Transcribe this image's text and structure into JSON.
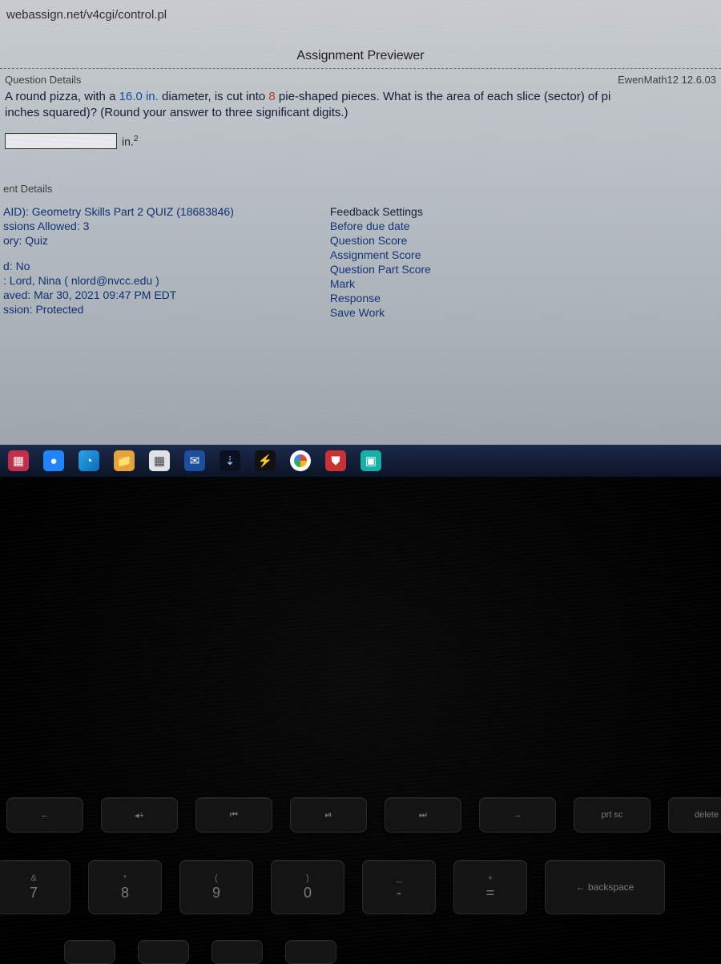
{
  "url": "webassign.net/v4cgi/control.pl",
  "page_title": "Assignment Previewer",
  "question_details": {
    "label": "Question Details",
    "source_ref": "EwenMath12 12.6.03"
  },
  "question": {
    "text_pre": "A round pizza, with a ",
    "diameter": "16.0 in.",
    "text_mid": " diameter, is cut into ",
    "pieces": "8",
    "text_post": " pie-shaped pieces. What is the area of each slice (sector) of pi",
    "round_note": "inches squared)? (Round your answer to three significant digits.)",
    "unit": "in.",
    "unit_exp": "2"
  },
  "assignment_details": {
    "header": "ent Details",
    "left": [
      "AID): Geometry Skills Part 2 QUIZ (18683846)",
      "ssions Allowed: 3",
      "ory: Quiz",
      "",
      "d: No",
      ": Lord, Nina ( nlord@nvcc.edu )",
      "aved: Mar 30, 2021 09:47 PM EDT",
      "ssion: Protected"
    ],
    "right_header": "Feedback Settings",
    "right": [
      "Before due date",
      "Question Score",
      "Assignment Score",
      "Question Part Score",
      "Mark",
      "Response",
      "Save Work"
    ]
  },
  "keyboard": {
    "fn_keys": [
      "←",
      "◂+",
      "⏮",
      "⏯",
      "⏭",
      "→",
      "prt sc",
      "delete"
    ],
    "num_row": [
      {
        "upper": "&",
        "main": "7"
      },
      {
        "upper": "*",
        "main": "8"
      },
      {
        "upper": "(",
        "main": "9"
      },
      {
        "upper": ")",
        "main": "0"
      },
      {
        "upper": "_",
        "main": "-"
      },
      {
        "upper": "+",
        "main": "="
      },
      {
        "upper": "",
        "main": "←  backspace"
      }
    ]
  }
}
